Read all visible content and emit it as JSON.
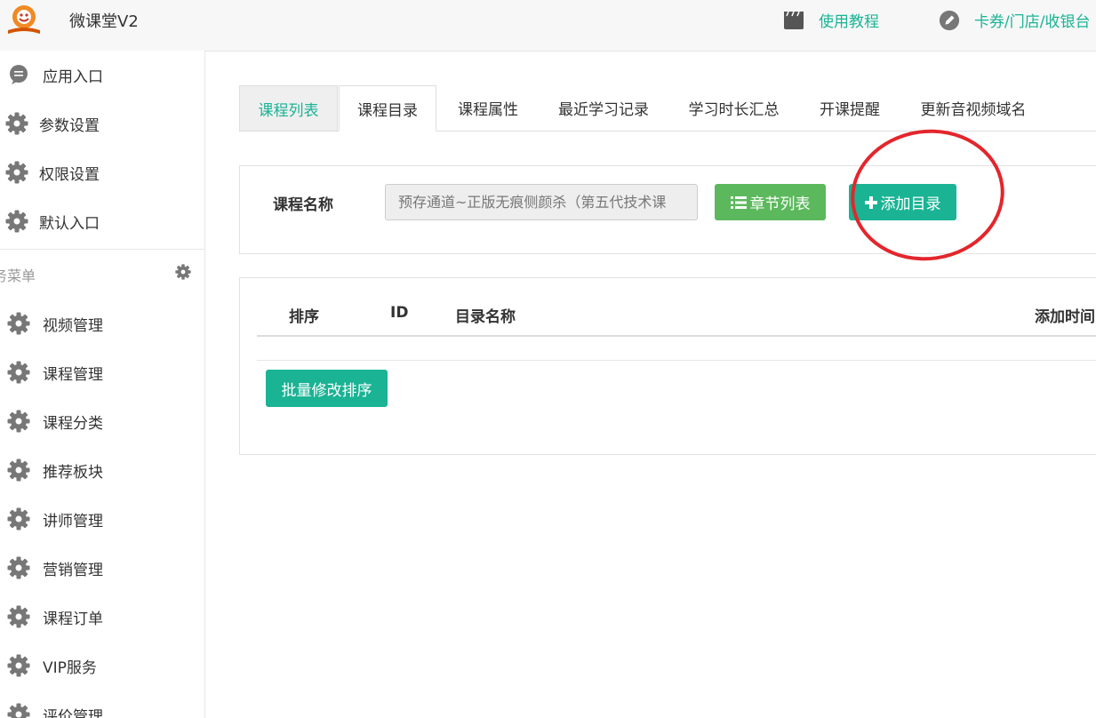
{
  "header": {
    "app_title": "微课堂V2",
    "tutorial_label": "使用教程",
    "tutorial_icon": "clapperboard-icon",
    "card_label": "卡券/门店/收银台",
    "card_icon": "pencil-icon"
  },
  "sidebar": {
    "items": [
      {
        "label": "应用入口",
        "icon": "chat-icon"
      },
      {
        "label": "参数设置",
        "icon": "gear-icon"
      },
      {
        "label": "权限设置",
        "icon": "gear-icon"
      },
      {
        "label": "默认入口",
        "icon": "gear-icon"
      }
    ],
    "section_title": "业务菜单",
    "section_visible": "务菜单",
    "menu": [
      {
        "label": "视频管理",
        "icon": "gear-icon"
      },
      {
        "label": "课程管理",
        "icon": "gear-icon"
      },
      {
        "label": "课程分类",
        "icon": "gear-icon"
      },
      {
        "label": "推荐板块",
        "icon": "gear-icon"
      },
      {
        "label": "讲师管理",
        "icon": "gear-icon"
      },
      {
        "label": "营销管理",
        "icon": "gear-icon"
      },
      {
        "label": "课程订单",
        "icon": "gear-icon"
      },
      {
        "label": "VIP服务",
        "icon": "gear-icon"
      },
      {
        "label": "评价管理",
        "icon": "gear-icon"
      }
    ]
  },
  "tabs": [
    {
      "label": "课程列表"
    },
    {
      "label": "课程目录"
    },
    {
      "label": "课程属性"
    },
    {
      "label": "最近学习记录"
    },
    {
      "label": "学习时长汇总"
    },
    {
      "label": "开课提醒"
    },
    {
      "label": "更新音视频域名"
    }
  ],
  "form": {
    "course_label": "课程名称",
    "course_value": "预存通道~正版无痕侧颜杀（第五代技术课",
    "chapter_list_label": "章节列表",
    "add_catalog_label": "添加目录"
  },
  "table": {
    "columns": [
      "排序",
      "ID",
      "目录名称",
      "添加时间"
    ],
    "rows": [],
    "batch_sort_label": "批量修改排序"
  },
  "colors": {
    "accent": "#1ab394",
    "green_button": "#5cb85c",
    "annotation": "#e3262c"
  }
}
